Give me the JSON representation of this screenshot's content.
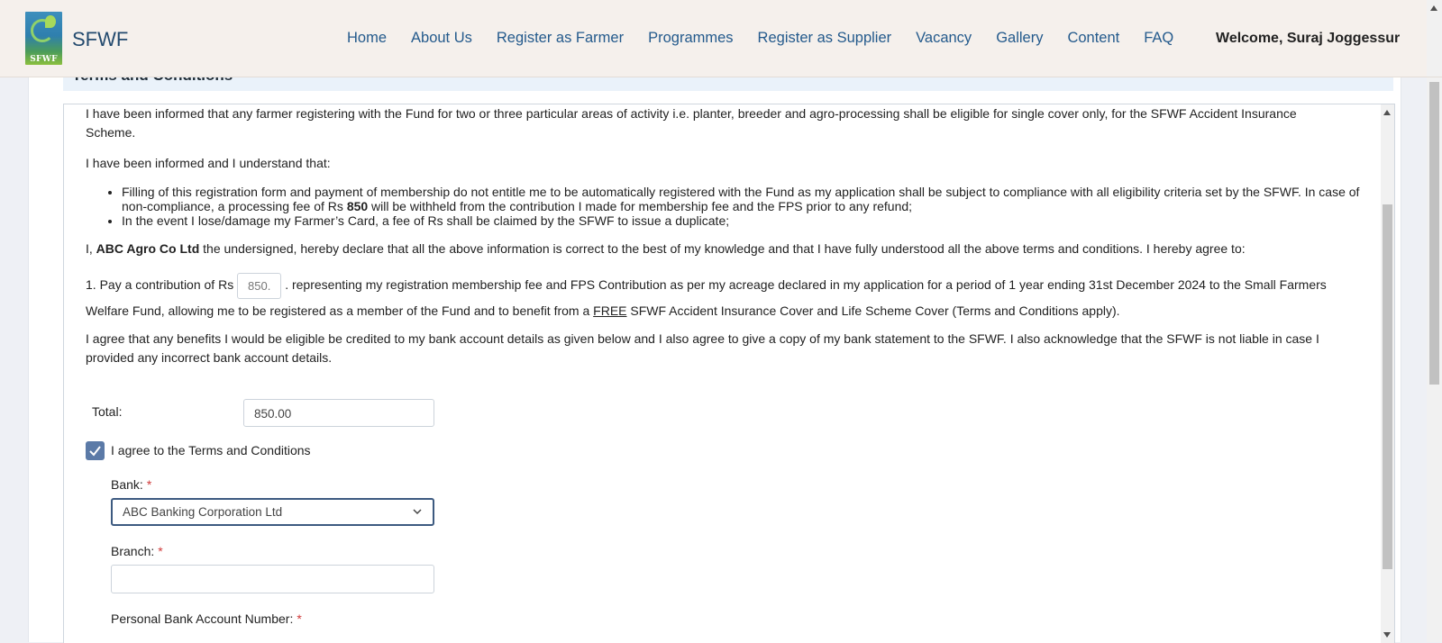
{
  "header": {
    "logo_text": "SFWF",
    "brand": "SFWF",
    "nav": [
      "Home",
      "About Us",
      "Register as Farmer",
      "Programmes",
      "Register as Supplier",
      "Vacancy",
      "Gallery",
      "Content",
      "FAQ"
    ],
    "welcome": "Welcome, Suraj Joggessur"
  },
  "section": {
    "title": "Terms and Conditions"
  },
  "terms": {
    "p1": "I have been informed that any farmer registering with the Fund for two or three particular areas of activity i.e. planter, breeder and agro-processing shall be eligible for single cover only, for the SFWF Accident Insurance Scheme.",
    "p2": "I have been informed and I understand that:",
    "b1_a": "Filling of this registration form and payment of membership do not entitle me to be automatically registered with the Fund as my application shall be subject to compliance with all eligibility criteria set by the SFWF. In case of non-compliance, a processing fee of Rs ",
    "b1_amount": "850",
    "b1_b": " will be withheld from the contribution I made for membership fee and the FPS prior to any refund;",
    "b2": "In the event I lose/damage my Farmer’s Card, a fee of Rs shall be claimed by the SFWF to issue a duplicate;",
    "p3_a": "I, ",
    "p3_name": "ABC Agro Co Ltd",
    "p3_b": " the undersigned, hereby declare that all the above information is correct to the best of my knowledge and that I have fully understood all the above terms and conditions. I hereby agree to:",
    "p4_a": "1. Pay a contribution of Rs",
    "p4_amount": "850.",
    "p4_b": ". representing my registration membership fee and FPS Contribution as per my acreage declared in my application for a period of 1 year ending 31st December 2024 to the Small Farmers Welfare Fund, allowing me to be registered as a member of the Fund and to benefit from a ",
    "p4_free": "FREE",
    "p4_c": " SFWF Accident Insurance Cover and Life Scheme Cover (Terms and Conditions apply).",
    "p5": "I agree that any benefits I would be eligible be credited to my bank account details as given below and I also agree to give a copy of my bank statement to the SFWF. I also acknowledge that the SFWF is not liable in case I provided any incorrect bank account details."
  },
  "form": {
    "total_label": "Total:",
    "total_value": "850.00",
    "agree_label": "I agree to the Terms and Conditions",
    "agree_checked": true,
    "bank_label": "Bank:",
    "bank_value": "ABC Banking Corporation Ltd",
    "branch_label": "Branch:",
    "branch_value": "",
    "account_label": "Personal Bank Account Number:",
    "required_mark": "*"
  },
  "colors": {
    "header_bg": "#f5f0ec",
    "nav_link": "#245a8c",
    "checkbox": "#5b7aa7",
    "select_border": "#3d5a80",
    "required": "#d03b3b"
  }
}
